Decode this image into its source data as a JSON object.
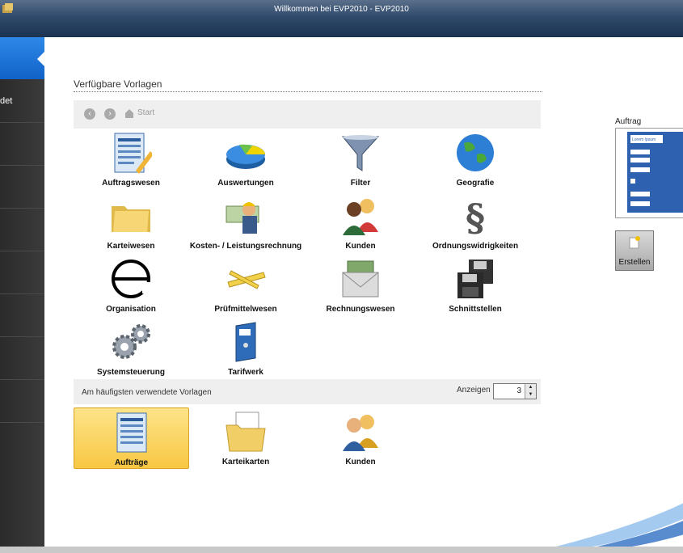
{
  "window": {
    "title": "Willkommen bei EVP2010 - EVP2010"
  },
  "sidebar": {
    "partial_label": "det"
  },
  "templates": {
    "section_title": "Verfügbare Vorlagen",
    "toolbar": {
      "start_label": "Start"
    },
    "items": [
      {
        "label": "Auftragswesen",
        "icon": "form-pencil-icon"
      },
      {
        "label": "Auswertungen",
        "icon": "pie-chart-icon"
      },
      {
        "label": "Filter",
        "icon": "funnel-icon"
      },
      {
        "label": "Geografie",
        "icon": "globe-icon"
      },
      {
        "label": "Karteiwesen",
        "icon": "folders-icon"
      },
      {
        "label": "Kosten- / Leistungsrechnung",
        "icon": "worker-money-icon"
      },
      {
        "label": "Kunden",
        "icon": "people-icon"
      },
      {
        "label": "Ordnungswidrigkeiten",
        "icon": "paragraph-icon"
      },
      {
        "label": "Organisation",
        "icon": "e-logo-icon"
      },
      {
        "label": "Prüfmittelwesen",
        "icon": "folding-ruler-icon"
      },
      {
        "label": "Rechnungswesen",
        "icon": "money-envelope-icon"
      },
      {
        "label": "Schnittstellen",
        "icon": "floppy-disks-icon"
      },
      {
        "label": "Systemsteuerung",
        "icon": "gears-icon"
      },
      {
        "label": "Tarifwerk",
        "icon": "binder-icon"
      }
    ]
  },
  "frequent": {
    "title": "Am häufigsten verwendete Vorlagen",
    "show_label": "Anzeigen",
    "show_value": "3",
    "items": [
      {
        "label": "Aufträge",
        "icon": "form-icon",
        "selected": true
      },
      {
        "label": "Karteikarten",
        "icon": "folder-cards-icon",
        "selected": false
      },
      {
        "label": "Kunden",
        "icon": "people-icon",
        "selected": false
      }
    ]
  },
  "preview": {
    "label": "Auftrag",
    "doc_title": "Lorem Ipsum"
  },
  "create": {
    "label": "Erstellen"
  },
  "colors": {
    "accent": "#1a6fd6",
    "selection": "#f8c743",
    "titlebar": "#2f4a6c"
  }
}
